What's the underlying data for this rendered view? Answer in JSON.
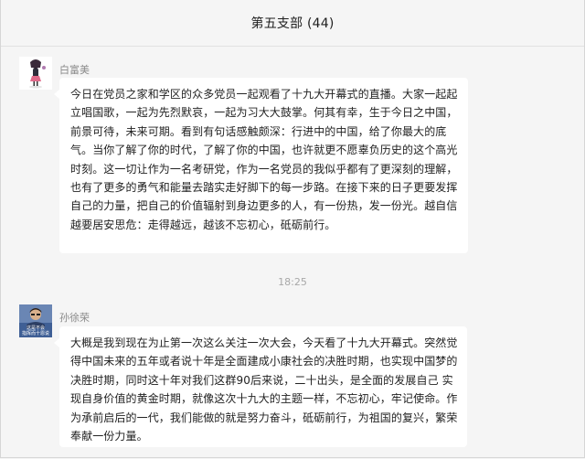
{
  "header": {
    "title": "第五支部 (44)"
  },
  "messages": [
    {
      "sender": "白富美",
      "text": "今日在党员之家和学区的众多党员一起观看了十九大开幕式的直播。大家一起起立唱国歌，一起为先烈默哀，一起为习大大鼓掌。何其有幸，生于今日之中国，前景可待，未来可期。看到有句话感触颇深：行进中的中国，给了你最大的底气。当你了解了你的时代，了解了你的中国，也许就更不愿辜负历史的这个高光时刻。这一切让作为一名考研党，作为一名党员的我似乎都有了更深刻的理解，也有了更多的勇气和能量去踏实走好脚下的每一步路。在接下来的日子更要发挥自己的力量，把自己的价值辐射到身边更多的人，有一份热，发一份光。越自信越要居安思危：走得越远，越该不忘初心，砥砺前行。"
    },
    {
      "sender": "孙徐荣",
      "avatar_caption": "这是不会\n指挥而十恩说",
      "text": "大概是我到现在为止第一次这么关注一次大会，今天看了十九大开幕式。突然觉得中国未来的五年或者说十年是全面建成小康社会的决胜时期，也实现中国梦的决胜时期，同时这十年对我们这群90后来说，二十出头，是全面的发展自己 实现自身价值的黄金时期，就像这次十九大的主题一样，不忘初心，牢记使命。作为承前启后的一代，我们能做的就是努力奋斗，砥砺前行，为祖国的复兴，繁荣奉献一份力量。"
    }
  ],
  "timestamp": "18:25"
}
